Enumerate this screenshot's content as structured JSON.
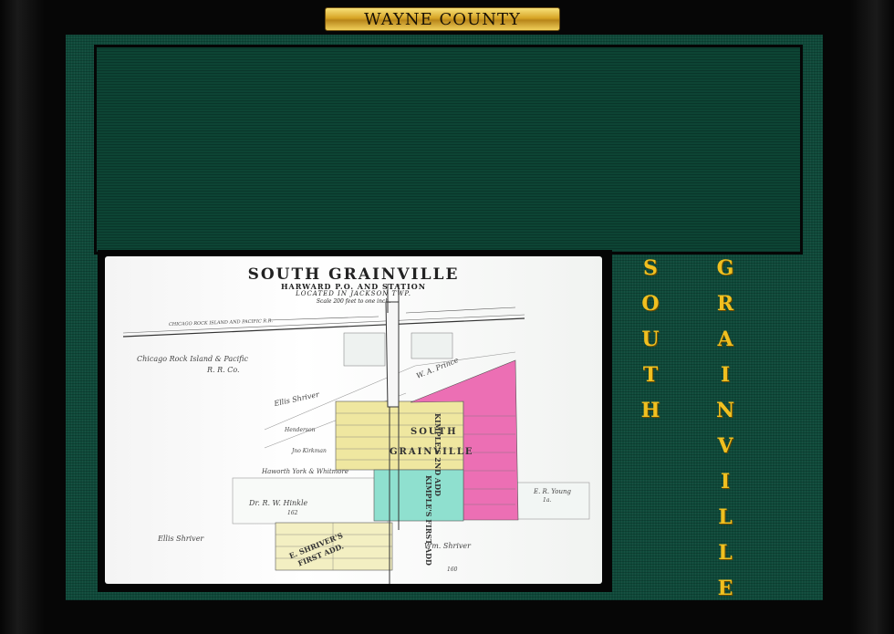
{
  "plaque": {
    "text": "WAYNE COUNTY"
  },
  "map": {
    "title": "SOUTH GRAINVILLE",
    "subtitle": "HARWARD P.O. AND STATION",
    "located": "LOCATED IN JACKSON TWP.",
    "scale": "Scale 200 feet to one inch.",
    "labels": {
      "railroad_top": "CHICAGO ROCK ISLAND AND PACIFIC R.R.",
      "railroad_co_1": "Chicago Rock Island & Pacific",
      "railroad_co_2": "R. R. Co.",
      "prince": "W. A. Prince",
      "ellis_shriver_1": "Ellis Shriver",
      "henderson": "Henderson",
      "kirkman": "Jno Kirkman",
      "haworth": "Haworth York & Whitmore",
      "hinkle": "Dr. R. W. Hinkle",
      "hinkle_acres": "162",
      "young": "E. R. Young",
      "young_acres": "1a.",
      "ellis_shriver_2": "Ellis Shriver",
      "wm_shriver": "Wm. Shriver",
      "wm_acres": "160",
      "town_south": "SOUTH",
      "town_grainville": "GRAINVILLE",
      "kimples_2nd": "KIMPLE'S 2ND ADD",
      "kimples_first": "KIMPLE'S FIRST ADD",
      "shriver_add_1": "E. SHRIVER'S",
      "shriver_add_2": "FIRST ADD."
    },
    "colors": {
      "yellow": "#efe7a0",
      "pink": "#ec6fb4",
      "cyan": "#8fe0cf"
    }
  },
  "side": {
    "word1": [
      "S",
      "O",
      "U",
      "T",
      "H"
    ],
    "word2": [
      "G",
      "R",
      "A",
      "I",
      "N",
      "V",
      "I",
      "L",
      "L",
      "E"
    ]
  }
}
